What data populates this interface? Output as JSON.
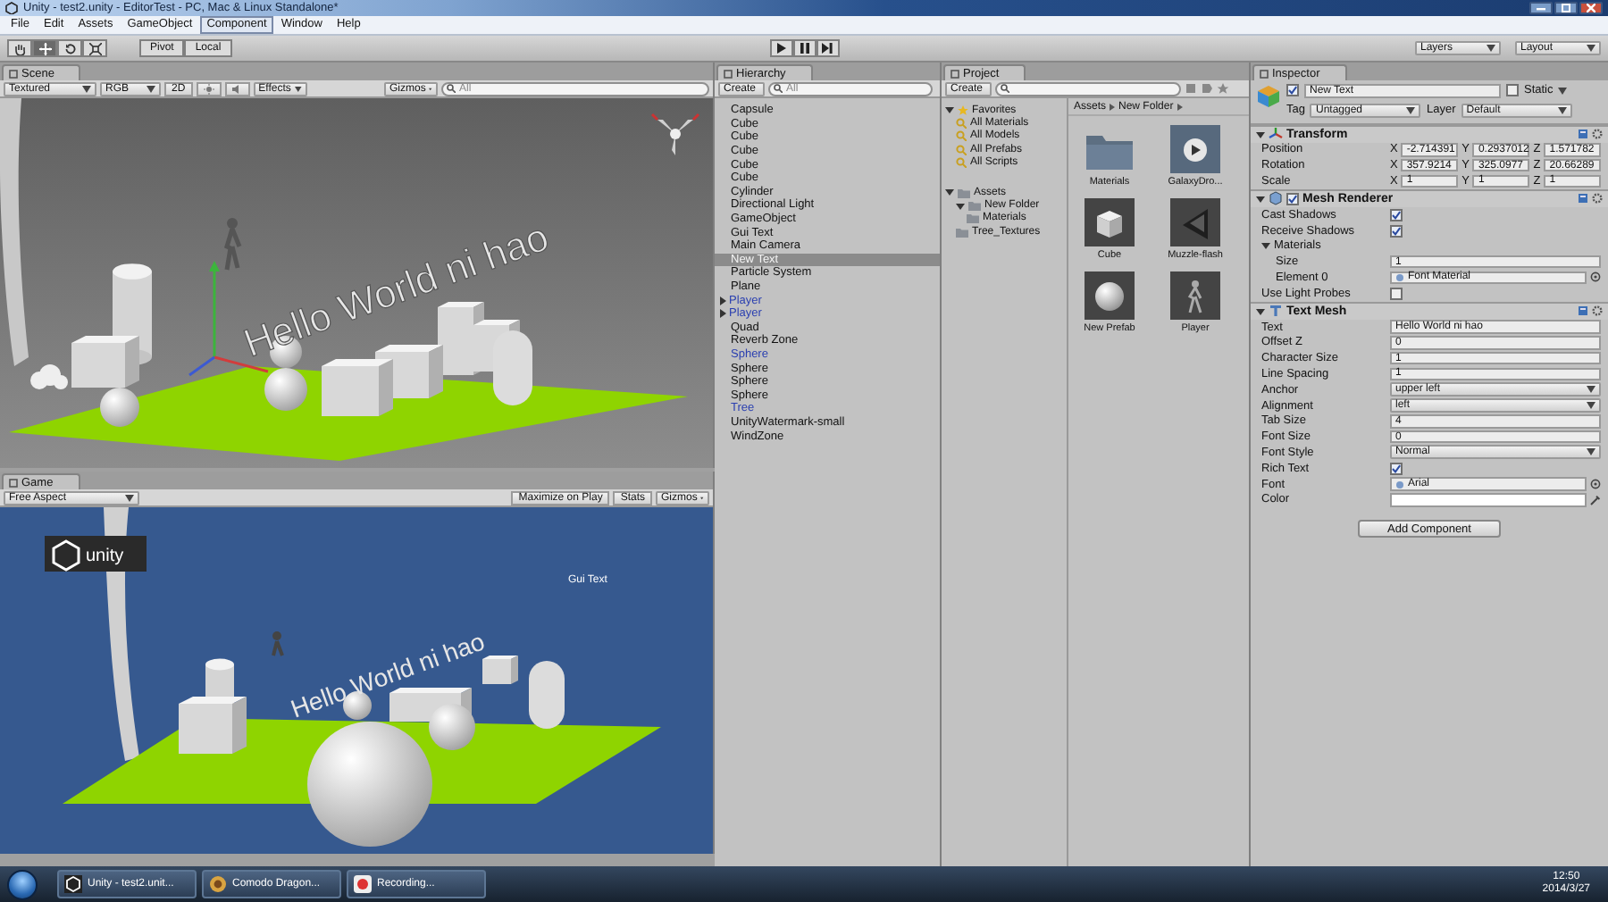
{
  "window": {
    "title": "Unity - test2.unity - EditorTest - PC, Mac & Linux Standalone*",
    "menu": [
      {
        "label": "File",
        "highlighted": false
      },
      {
        "label": "Edit",
        "highlighted": false
      },
      {
        "label": "Assets",
        "highlighted": false
      },
      {
        "label": "GameObject",
        "highlighted": false
      },
      {
        "label": "Component",
        "highlighted": true
      },
      {
        "label": "Window",
        "highlighted": false
      },
      {
        "label": "Help",
        "highlighted": false
      }
    ]
  },
  "toolbar": {
    "tools": [
      {
        "kind": "hand",
        "selected": false
      },
      {
        "kind": "move",
        "selected": true
      },
      {
        "kind": "rotate",
        "selected": false
      },
      {
        "kind": "scale",
        "selected": false
      }
    ],
    "pivot": "Pivot",
    "local": "Local",
    "layers": "Layers",
    "layout": "Layout"
  },
  "scene": {
    "tab": "Scene",
    "shading": "Textured",
    "rgb": "RGB",
    "mode_2d": "2D",
    "lighting": false,
    "audio": false,
    "effects": "Effects",
    "gizmos": "Gizmos",
    "search_placeholder": "All",
    "label_3d": "Hello World ni hao"
  },
  "game": {
    "tab": "Game",
    "aspect": "Free Aspect",
    "buttons": [
      "Maximize on Play",
      "Stats",
      "Gizmos"
    ],
    "logo": "unity",
    "gui_text": "Gui Text",
    "label_3d": "Hello World ni hao"
  },
  "hierarchy": {
    "tab": "Hierarchy",
    "create": "Create",
    "search_placeholder": "All",
    "items": [
      {
        "name": "Capsule",
        "selected": false,
        "prefab": false
      },
      {
        "name": "Cube",
        "selected": false,
        "prefab": false
      },
      {
        "name": "Cube",
        "selected": false,
        "prefab": false
      },
      {
        "name": "Cube",
        "selected": false,
        "prefab": false
      },
      {
        "name": "Cube",
        "selected": false,
        "prefab": false
      },
      {
        "name": "Cube",
        "selected": false,
        "prefab": false
      },
      {
        "name": "Cylinder",
        "selected": false,
        "prefab": false
      },
      {
        "name": "Directional Light",
        "selected": false,
        "prefab": false
      },
      {
        "name": "GameObject",
        "selected": false,
        "prefab": false
      },
      {
        "name": "Gui Text",
        "selected": false,
        "prefab": false
      },
      {
        "name": "Main Camera",
        "selected": false,
        "prefab": false
      },
      {
        "name": "New Text",
        "selected": true,
        "prefab": false
      },
      {
        "name": "Particle System",
        "selected": false,
        "prefab": false
      },
      {
        "name": "Plane",
        "selected": false,
        "prefab": false
      },
      {
        "name": "Player",
        "selected": false,
        "prefab": true,
        "expanded": false
      },
      {
        "name": "Player",
        "selected": false,
        "prefab": true,
        "expanded": false
      },
      {
        "name": "Quad",
        "selected": false,
        "prefab": false
      },
      {
        "name": "Reverb Zone",
        "selected": false,
        "prefab": false
      },
      {
        "name": "Sphere",
        "selected": false,
        "prefab": true
      },
      {
        "name": "Sphere",
        "selected": false,
        "prefab": false
      },
      {
        "name": "Sphere",
        "selected": false,
        "prefab": false
      },
      {
        "name": "Sphere",
        "selected": false,
        "prefab": false
      },
      {
        "name": "Tree",
        "selected": false,
        "prefab": true
      },
      {
        "name": "UnityWatermark-small",
        "selected": false,
        "prefab": false
      },
      {
        "name": "WindZone",
        "selected": false,
        "prefab": false
      }
    ]
  },
  "project": {
    "tab": "Project",
    "create": "Create",
    "tree": [
      {
        "label": "Favorites",
        "kind": "favorites",
        "expanded": true,
        "children": [
          {
            "label": "All Materials",
            "kind": "search"
          },
          {
            "label": "All Models",
            "kind": "search"
          },
          {
            "label": "All Prefabs",
            "kind": "search"
          },
          {
            "label": "All Scripts",
            "kind": "search"
          }
        ]
      },
      {
        "label": "Assets",
        "kind": "folder",
        "expanded": true,
        "children": [
          {
            "label": "New Folder",
            "kind": "folder",
            "expanded": true,
            "children": [
              {
                "label": "Materials",
                "kind": "folder"
              }
            ]
          },
          {
            "label": "Tree_Textures",
            "kind": "folder"
          }
        ]
      }
    ],
    "breadcrumb": [
      "Assets",
      "New Folder"
    ],
    "assets": [
      {
        "name": "Materials",
        "kind": "folder"
      },
      {
        "name": "GalaxyDro...",
        "kind": "media"
      },
      {
        "name": "Cube",
        "kind": "cube"
      },
      {
        "name": "Muzzle-flash",
        "kind": "effect"
      },
      {
        "name": "New Prefab",
        "kind": "sphere"
      },
      {
        "name": "Player",
        "kind": "character"
      }
    ]
  },
  "inspector": {
    "tab": "Inspector",
    "header": {
      "active": true,
      "name": "New Text",
      "static_label": "Static",
      "static": false,
      "tag_label": "Tag",
      "tag": "Untagged",
      "layer_label": "Layer",
      "layer": "Default"
    },
    "components": [
      {
        "title": "Transform",
        "kind": "transform",
        "expanded": true,
        "rows": [
          {
            "label": "Position",
            "kind": "vector",
            "values": [
              {
                "axis": "X",
                "value": "-2.714391"
              },
              {
                "axis": "Y",
                "value": "0.2937012"
              },
              {
                "axis": "Z",
                "value": "1.571782"
              }
            ]
          },
          {
            "label": "Rotation",
            "kind": "vector",
            "values": [
              {
                "axis": "X",
                "value": "357.9214"
              },
              {
                "axis": "Y",
                "value": "325.0977"
              },
              {
                "axis": "Z",
                "value": "20.66289"
              }
            ]
          },
          {
            "label": "Scale",
            "kind": "vector",
            "values": [
              {
                "axis": "X",
                "value": "1"
              },
              {
                "axis": "Y",
                "value": "1"
              },
              {
                "axis": "Z",
                "value": "1"
              }
            ]
          }
        ]
      },
      {
        "title": "Mesh Renderer",
        "kind": "renderer",
        "expanded": true,
        "enabled": true,
        "rows": [
          {
            "label": "Cast Shadows",
            "kind": "checkbox",
            "checked": true
          },
          {
            "label": "Receive Shadows",
            "kind": "checkbox",
            "checked": true
          },
          {
            "label": "Materials",
            "kind": "foldout",
            "expanded": true,
            "children": [
              {
                "label": "Size",
                "kind": "text",
                "value": "1"
              },
              {
                "label": "Element 0",
                "kind": "object",
                "value": "Font Material"
              }
            ]
          },
          {
            "label": "Use Light Probes",
            "kind": "checkbox",
            "checked": false
          }
        ]
      },
      {
        "title": "Text Mesh",
        "kind": "textmesh",
        "expanded": true,
        "rows": [
          {
            "label": "Text",
            "kind": "text",
            "value": "Hello World ni hao"
          },
          {
            "label": "Offset Z",
            "kind": "text",
            "value": "0"
          },
          {
            "label": "Character Size",
            "kind": "text",
            "value": "1"
          },
          {
            "label": "Line Spacing",
            "kind": "text",
            "value": "1"
          },
          {
            "label": "Anchor",
            "kind": "dropdown",
            "value": "upper left"
          },
          {
            "label": "Alignment",
            "kind": "dropdown",
            "value": "left"
          },
          {
            "label": "Tab Size",
            "kind": "text",
            "value": "4"
          },
          {
            "label": "Font Size",
            "kind": "text",
            "value": "0"
          },
          {
            "label": "Font Style",
            "kind": "dropdown",
            "value": "Normal"
          },
          {
            "label": "Rich Text",
            "kind": "checkbox",
            "checked": true
          },
          {
            "label": "Font",
            "kind": "object",
            "value": "Arial"
          },
          {
            "label": "Color",
            "kind": "color",
            "color": "#ffffff"
          }
        ]
      }
    ],
    "add_button": "Add Component"
  },
  "taskbar": {
    "items": [
      {
        "label": "Unity - test2.unit...",
        "kind": "unity"
      },
      {
        "label": "Comodo Dragon...",
        "kind": "browser"
      },
      {
        "label": "Recording...",
        "kind": "recorder"
      }
    ],
    "time": "12:50",
    "date": "2014/3/27"
  }
}
